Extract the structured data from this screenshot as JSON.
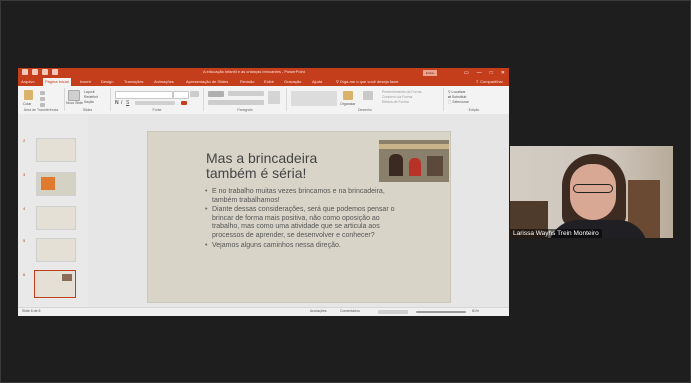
{
  "app": {
    "window_title": "A educação infantil e as crianças brincantes - PowerPoint",
    "signin_label": "Entrar",
    "share_label": "Compartilhar",
    "tell_me": "Diga-me o que você deseja fazer"
  },
  "ribbon": {
    "tabs": [
      "Arquivo",
      "Página Inicial",
      "Inserir",
      "Design",
      "Transições",
      "Animações",
      "Apresentação de Slides",
      "Revisão",
      "Exibir",
      "Gravação",
      "Ajuda"
    ],
    "active_tab": "Página Inicial",
    "groups": {
      "clipboard": "Área de Transferência",
      "slides": "Slides",
      "font": "Fonte",
      "paragraph": "Parágrafo",
      "drawing": "Desenho",
      "editing": "Edição"
    },
    "buttons": {
      "paste": "Colar",
      "new_slide": "Novo Slide",
      "layout": "Layout",
      "reset": "Redefinir",
      "section": "Seção",
      "arrange": "Organizar",
      "quick_styles": "Estilos Rápidos",
      "shape_fill": "Preenchimento da Forma",
      "shape_outline": "Contorno da Forma",
      "shape_effects": "Efeitos de Forma",
      "find": "Localizar",
      "replace": "Substituir",
      "select": "Selecionar"
    }
  },
  "slides_panel": {
    "numbers": [
      "2",
      "3",
      "4",
      "5",
      "6"
    ],
    "selected": "6"
  },
  "slide": {
    "title": "Mas a brincadeira também é séria!",
    "bullets": [
      "E no trabalho muitas vezes brincamos e na brincadeira, também trabalhamos!",
      "Diante dessas considerações, será que podemos pensar o brincar de forma mais positiva, não como oposição ao trabalho, mas como uma atividade que se articula aos processos de aprender, se desenvolver e conhecer?",
      "Vejamos alguns caminhos nessa direção."
    ]
  },
  "statusbar": {
    "slide_info": "Slide 6 de 6",
    "notes": "Anotações",
    "comments": "Comentários",
    "zoom": "81%"
  },
  "video": {
    "participant_name": "Larissa Wayhs Trein Monteiro"
  },
  "colors": {
    "accent": "#c43e1c",
    "slide_bg": "#d8d5c8"
  }
}
